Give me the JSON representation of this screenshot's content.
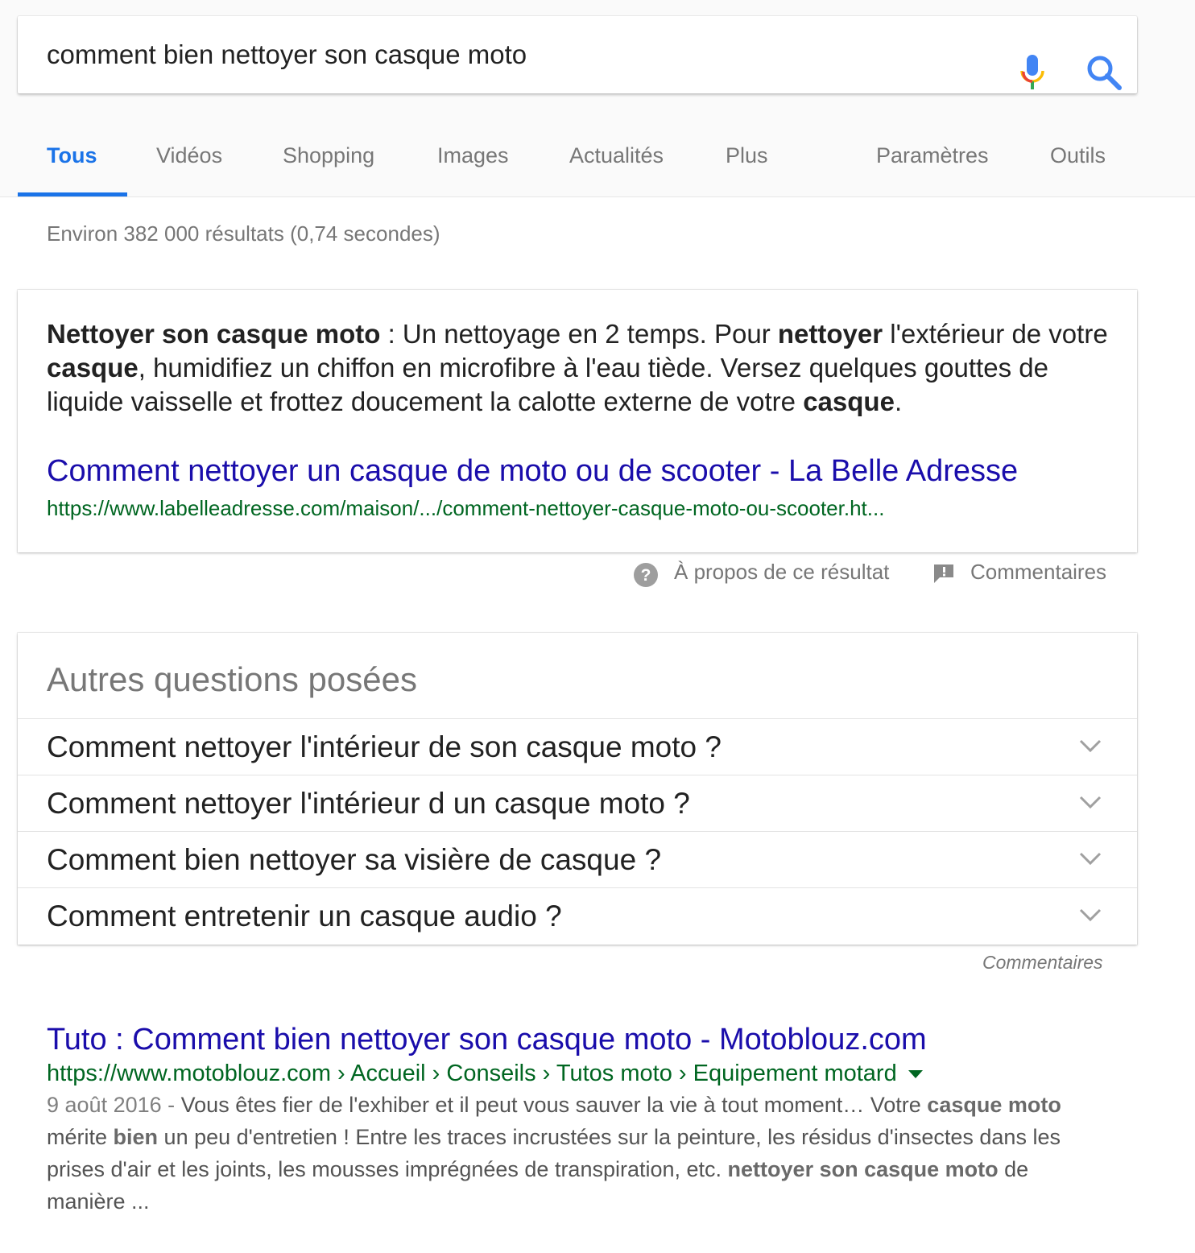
{
  "search": {
    "query": "comment bien nettoyer son casque moto",
    "mic_icon": "microphone-icon",
    "search_icon": "search-icon"
  },
  "tabs": [
    {
      "label": "Tous",
      "active": true
    },
    {
      "label": "Vidéos"
    },
    {
      "label": "Shopping"
    },
    {
      "label": "Images"
    },
    {
      "label": "Actualités"
    },
    {
      "label": "Plus"
    },
    {
      "label": "Paramètres"
    },
    {
      "label": "Outils"
    }
  ],
  "result_stats": "Environ 382 000 résultats (0,74 secondes)",
  "featured_snippet": {
    "parts": [
      {
        "text": "Nettoyer son casque moto",
        "bold": true
      },
      {
        "text": " : Un nettoyage en 2 temps. Pour ",
        "bold": false
      },
      {
        "text": "nettoyer",
        "bold": true
      },
      {
        "text": " l'extérieur de votre ",
        "bold": false
      },
      {
        "text": "casque",
        "bold": true
      },
      {
        "text": ", humidifiez un chiffon en microfibre à l'eau tiède. Versez quelques gouttes de liquide vaisselle et frottez doucement la calotte externe de votre ",
        "bold": false
      },
      {
        "text": "casque",
        "bold": true
      },
      {
        "text": ".",
        "bold": false
      }
    ],
    "title": "Comment nettoyer un casque de moto ou de scooter - La Belle Adresse",
    "url": "https://www.labelleadresse.com/maison/.../comment-nettoyer-casque-moto-ou-scooter.ht..."
  },
  "feedback": {
    "about": "À propos de ce résultat",
    "comments": "Commentaires"
  },
  "paa": {
    "title": "Autres questions posées",
    "questions": [
      "Comment nettoyer l'intérieur de son casque moto ?",
      "Comment nettoyer l'intérieur d un casque moto ?",
      "Comment bien nettoyer sa visière de casque ?",
      "Comment entretenir un casque audio ?"
    ],
    "comments": "Commentaires"
  },
  "organic": {
    "title": "Tuto : Comment bien nettoyer son casque moto - Motoblouz.com",
    "url": "https://www.motoblouz.com › Accueil › Conseils › Tutos moto › Equipement motard",
    "date": "9 août 2016 - ",
    "snippet_parts": [
      {
        "text": "Vous êtes fier de l'exhiber et il peut vous sauver la vie à tout moment… Votre ",
        "bold": false
      },
      {
        "text": "casque moto",
        "bold": true
      },
      {
        "text": " mérite ",
        "bold": false
      },
      {
        "text": "bien",
        "bold": true
      },
      {
        "text": " un peu d'entretien ! Entre les traces incrustées sur la peinture, les résidus d'insectes dans les prises d'air et les joints, les mousses imprégnées de transpiration, etc. ",
        "bold": false
      },
      {
        "text": "nettoyer son casque moto",
        "bold": true
      },
      {
        "text": " de manière ...",
        "bold": false
      }
    ]
  },
  "colors": {
    "accent_blue": "#1a73e8",
    "link_blue": "#1a0dab",
    "url_green": "#006621"
  }
}
